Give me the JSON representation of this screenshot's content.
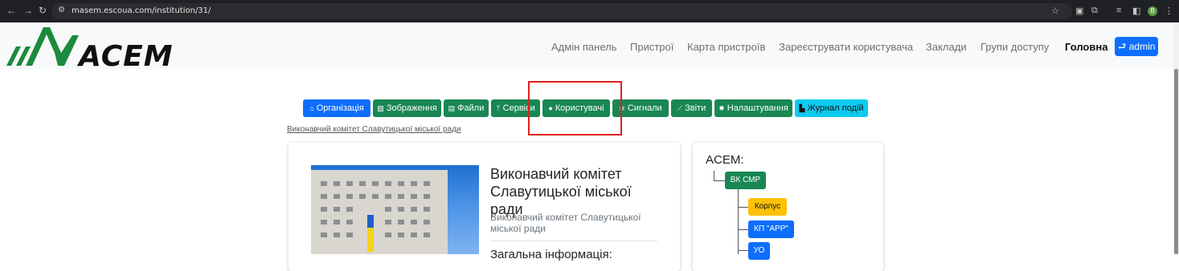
{
  "browser": {
    "url": "masem.escoua.com/institution/31/",
    "profile_initial": "B",
    "back": "←",
    "forward": "→",
    "reload": "↻"
  },
  "header": {
    "logo_text": "ACEM",
    "nav": [
      "Адмін панель",
      "Пристрої",
      "Карта пристроїв",
      "Зареєструвати користувача",
      "Заклади",
      "Групи доступу",
      "Головна"
    ],
    "admin_label": "admin"
  },
  "tabs": [
    {
      "label": "Організація",
      "icon": "home-icon",
      "color": "#0d6efd"
    },
    {
      "label": "Зображення",
      "icon": "image-icon",
      "color": "#198754"
    },
    {
      "label": "Файли",
      "icon": "file-icon",
      "color": "#198754"
    },
    {
      "label": "Сервіси",
      "icon": "plug-icon",
      "color": "#198754"
    },
    {
      "label": "Користувачі",
      "icon": "user-icon",
      "color": "#198754"
    },
    {
      "label": "Сигнали",
      "icon": "wifi-icon",
      "color": "#198754"
    },
    {
      "label": "Звіти",
      "icon": "chart-icon",
      "color": "#198754"
    },
    {
      "label": "Налаштування",
      "icon": "gear-icon",
      "color": "#198754"
    },
    {
      "label": "Журнал подій",
      "icon": "journal-icon",
      "color": "#0dcaf0"
    }
  ],
  "breadcrumb": "Виконавчий комітет Славутицької міської ради",
  "org": {
    "title": "Виконавчий комітет Славутицької міської ради",
    "subtitle": "Виконавчий комітет Славутицької міської ради",
    "section": "Загальна інформація:"
  },
  "tree": {
    "title": "ACEM:",
    "root": "ВК СМР",
    "children": [
      "Корпус",
      "КП \"АРР\"",
      "УО"
    ]
  },
  "colors": {
    "accent": "#0d6efd",
    "success": "#198754",
    "info": "#0dcaf0",
    "warning": "#ffc107",
    "highlight": "#e02020"
  }
}
